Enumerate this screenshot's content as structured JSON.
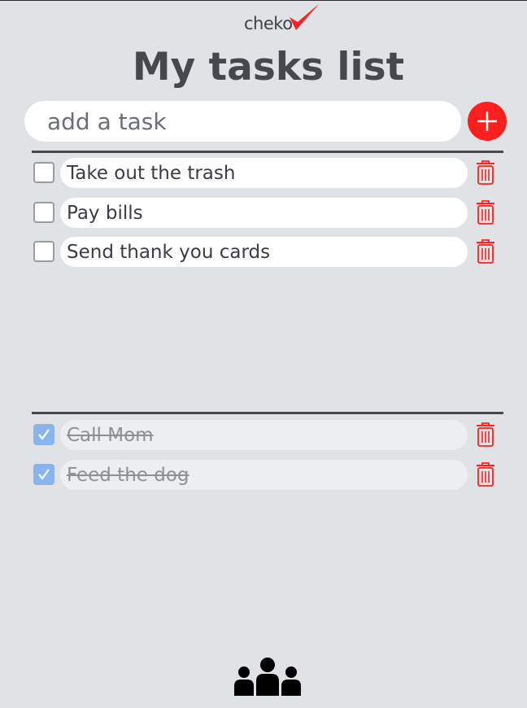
{
  "logo": {
    "text": "cheko",
    "mark": "checkmark-icon",
    "mark_color": "#ff1f1f"
  },
  "title": "My tasks list",
  "add_task": {
    "placeholder": "add a task",
    "value": "",
    "button_icon": "plus-icon",
    "button_color": "#ff1f1f"
  },
  "pending_tasks": [
    {
      "text": "Take out the trash",
      "done": false
    },
    {
      "text": "Pay bills",
      "done": false
    },
    {
      "text": "Send thank you cards",
      "done": false
    }
  ],
  "completed_tasks": [
    {
      "text": "Call Mom",
      "done": true
    },
    {
      "text": "Feed the dog",
      "done": true
    }
  ],
  "icons": {
    "delete": "trash-icon",
    "footer": "users-icon"
  },
  "colors": {
    "background": "#e0e3e6",
    "accent": "#ff1f1f",
    "checked": "#8bb3ec",
    "text": "#45484c"
  }
}
